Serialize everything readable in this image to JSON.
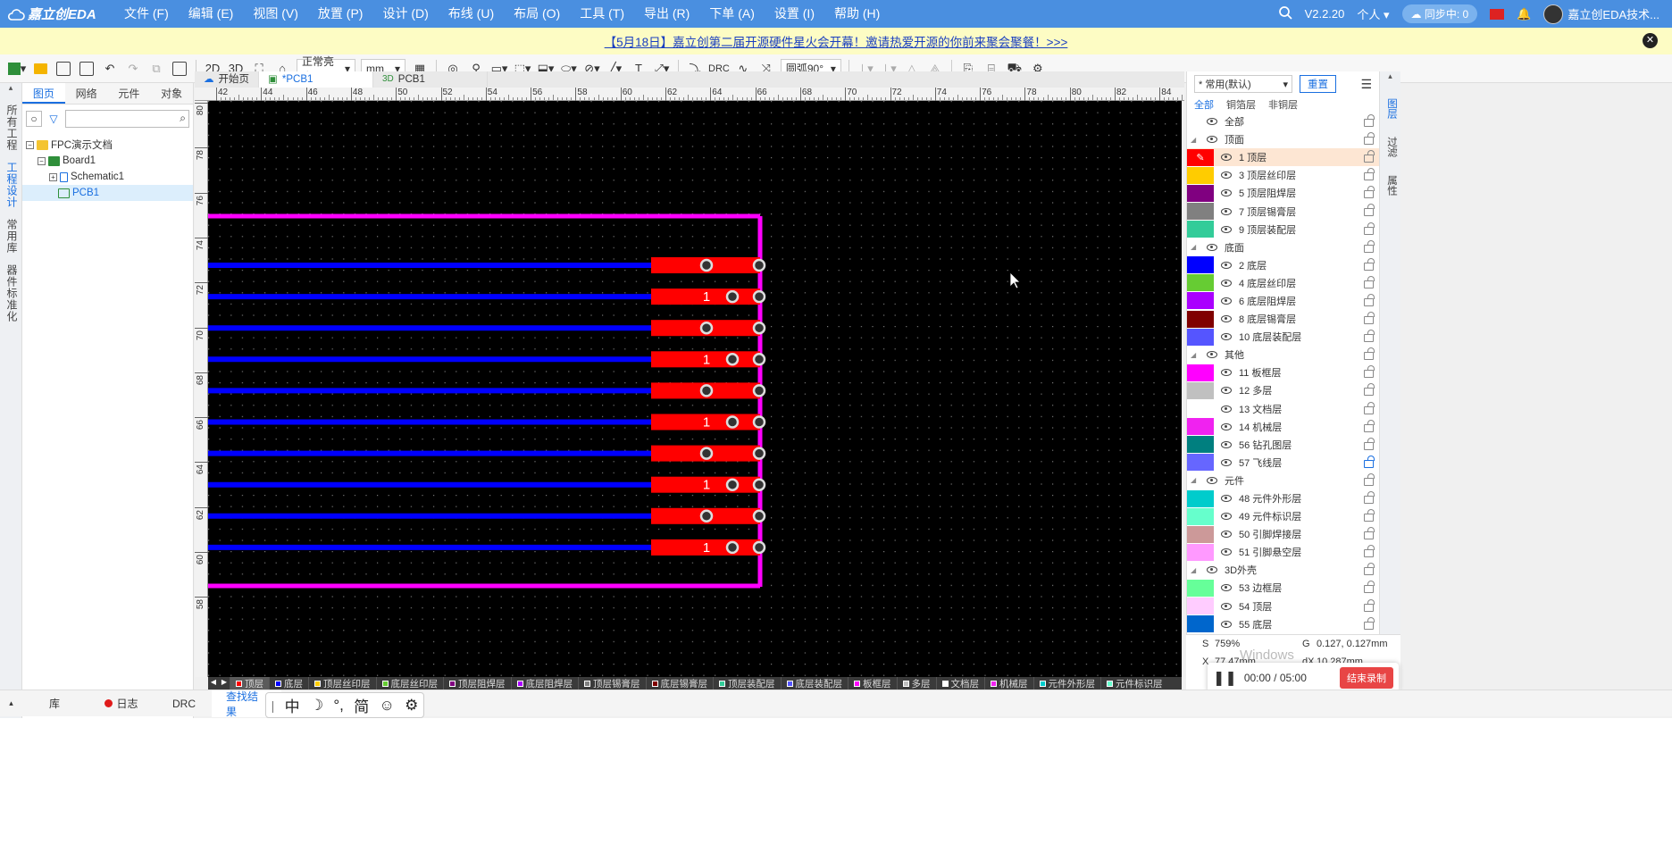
{
  "app": {
    "logo": "嘉立创EDA",
    "version": "V2.2.20",
    "user_mode": "个人",
    "sync": "同步中: 0",
    "user_name": "嘉立创EDA技术..."
  },
  "menu": [
    "文件 (F)",
    "编辑 (E)",
    "视图 (V)",
    "放置 (P)",
    "设计 (D)",
    "布线 (U)",
    "布局 (O)",
    "工具 (T)",
    "导出 (R)",
    "下单 (A)",
    "设置 (I)",
    "帮助 (H)"
  ],
  "banner": {
    "text": "【5月18日】嘉立创第二届开源硬件星火会开幕！邀请热爱开源的你前来聚会聚餐！>>>"
  },
  "toolbar": {
    "view2d": "2D",
    "view3d": "3D",
    "brightness": "正常亮度",
    "unit": "mm",
    "drc": "DRC",
    "arc": "圆弧90°"
  },
  "left_rail": [
    "所有工程",
    "工程设计",
    "常用库",
    "器件标准化"
  ],
  "left_tabs": [
    "图页",
    "网络",
    "元件",
    "对象"
  ],
  "tree": {
    "root": "FPC演示文档",
    "board": "Board1",
    "schematic": "Schematic1",
    "pcb": "PCB1"
  },
  "doc_tabs": [
    {
      "label": "开始页"
    },
    {
      "label": "*PCB1"
    },
    {
      "label": "PCB1"
    }
  ],
  "ruler": {
    "top": [
      "42",
      "44",
      "46",
      "48",
      "50",
      "52",
      "54",
      "56",
      "58",
      "60",
      "62",
      "64",
      "66",
      "68",
      "70",
      "72",
      "74",
      "76",
      "78",
      "80",
      "82",
      "84"
    ],
    "left": [
      "80",
      "78",
      "76",
      "74",
      "72",
      "70",
      "68",
      "66",
      "64",
      "62",
      "60",
      "58"
    ]
  },
  "pads": {
    "label": "1"
  },
  "layer_bar": [
    {
      "name": "顶层",
      "color": "#ff0000"
    },
    {
      "name": "底层",
      "color": "#0000ff"
    },
    {
      "name": "顶层丝印层",
      "color": "#ffcc00"
    },
    {
      "name": "底层丝印层",
      "color": "#66cc33"
    },
    {
      "name": "顶层阻焊层",
      "color": "#800080"
    },
    {
      "name": "底层阻焊层",
      "color": "#aa00ff"
    },
    {
      "name": "顶层锡膏层",
      "color": "#808080"
    },
    {
      "name": "底层锡膏层",
      "color": "#800000"
    },
    {
      "name": "顶层装配层",
      "color": "#33cc99"
    },
    {
      "name": "底层装配层",
      "color": "#5555ff"
    },
    {
      "name": "板框层",
      "color": "#ff00ff"
    },
    {
      "name": "多层",
      "color": "#c0c0c0"
    },
    {
      "name": "文档层",
      "color": "#ffffff"
    },
    {
      "name": "机械层",
      "color": "#f022f0"
    },
    {
      "name": "元件外形层",
      "color": "#00cccc"
    },
    {
      "name": "元件标识层",
      "color": "#66ffcc"
    }
  ],
  "right_panel": {
    "preset": "* 常用(默认)",
    "reset": "重置",
    "filters": [
      "全部",
      "铜箔层",
      "非铜层"
    ],
    "rows": [
      {
        "type": "group",
        "label": "全部"
      },
      {
        "type": "group",
        "label": "顶面"
      },
      {
        "type": "layer",
        "label": "1 顶层",
        "color": "#ff0000",
        "active": true
      },
      {
        "type": "layer",
        "label": "3 顶层丝印层",
        "color": "#ffcc00"
      },
      {
        "type": "layer",
        "label": "5 顶层阻焊层",
        "color": "#800080"
      },
      {
        "type": "layer",
        "label": "7 顶层锡膏层",
        "color": "#808080"
      },
      {
        "type": "layer",
        "label": "9 顶层装配层",
        "color": "#33cc99"
      },
      {
        "type": "group",
        "label": "底面"
      },
      {
        "type": "layer",
        "label": "2 底层",
        "color": "#0000ff"
      },
      {
        "type": "layer",
        "label": "4 底层丝印层",
        "color": "#66cc33"
      },
      {
        "type": "layer",
        "label": "6 底层阻焊层",
        "color": "#aa00ff"
      },
      {
        "type": "layer",
        "label": "8 底层锡膏层",
        "color": "#800000"
      },
      {
        "type": "layer",
        "label": "10 底层装配层",
        "color": "#5555ff"
      },
      {
        "type": "group",
        "label": "其他"
      },
      {
        "type": "layer",
        "label": "11 板框层",
        "color": "#ff00ff"
      },
      {
        "type": "layer",
        "label": "12 多层",
        "color": "#c0c0c0"
      },
      {
        "type": "layer",
        "label": "13 文档层",
        "color": "#ffffff"
      },
      {
        "type": "layer",
        "label": "14 机械层",
        "color": "#f022f0"
      },
      {
        "type": "layer",
        "label": "56 钻孔图层",
        "color": "#007f7f"
      },
      {
        "type": "layer",
        "label": "57 飞线层",
        "color": "#6666ff",
        "locked": true
      },
      {
        "type": "group",
        "label": "元件"
      },
      {
        "type": "layer",
        "label": "48 元件外形层",
        "color": "#00cccc"
      },
      {
        "type": "layer",
        "label": "49 元件标识层",
        "color": "#66ffcc"
      },
      {
        "type": "layer",
        "label": "50 引脚焊接层",
        "color": "#cc9999"
      },
      {
        "type": "layer",
        "label": "51 引脚悬空层",
        "color": "#ff99ff"
      },
      {
        "type": "group",
        "label": "3D外壳"
      },
      {
        "type": "layer",
        "label": "53 边框层",
        "color": "#66ff99"
      },
      {
        "type": "layer",
        "label": "54 顶层",
        "color": "#ffccff"
      },
      {
        "type": "layer",
        "label": "55 底层",
        "color": "#0066cc"
      }
    ]
  },
  "right_rail": [
    "图层",
    "过滤",
    "属性"
  ],
  "coords": {
    "s_label": "S",
    "s": "759%",
    "g_label": "G",
    "g": "0.127, 0.127mm",
    "x_label": "X",
    "x": "77.47mm",
    "dx_label": "dX",
    "dx": "10.287mm"
  },
  "recorder": {
    "time": "00:00 / 05:00",
    "stop": "结束录制"
  },
  "watermark": "Windows",
  "bottom_tabs": [
    "库",
    "日志",
    "DRC",
    "查找结果"
  ],
  "ime": [
    "中",
    "简"
  ]
}
